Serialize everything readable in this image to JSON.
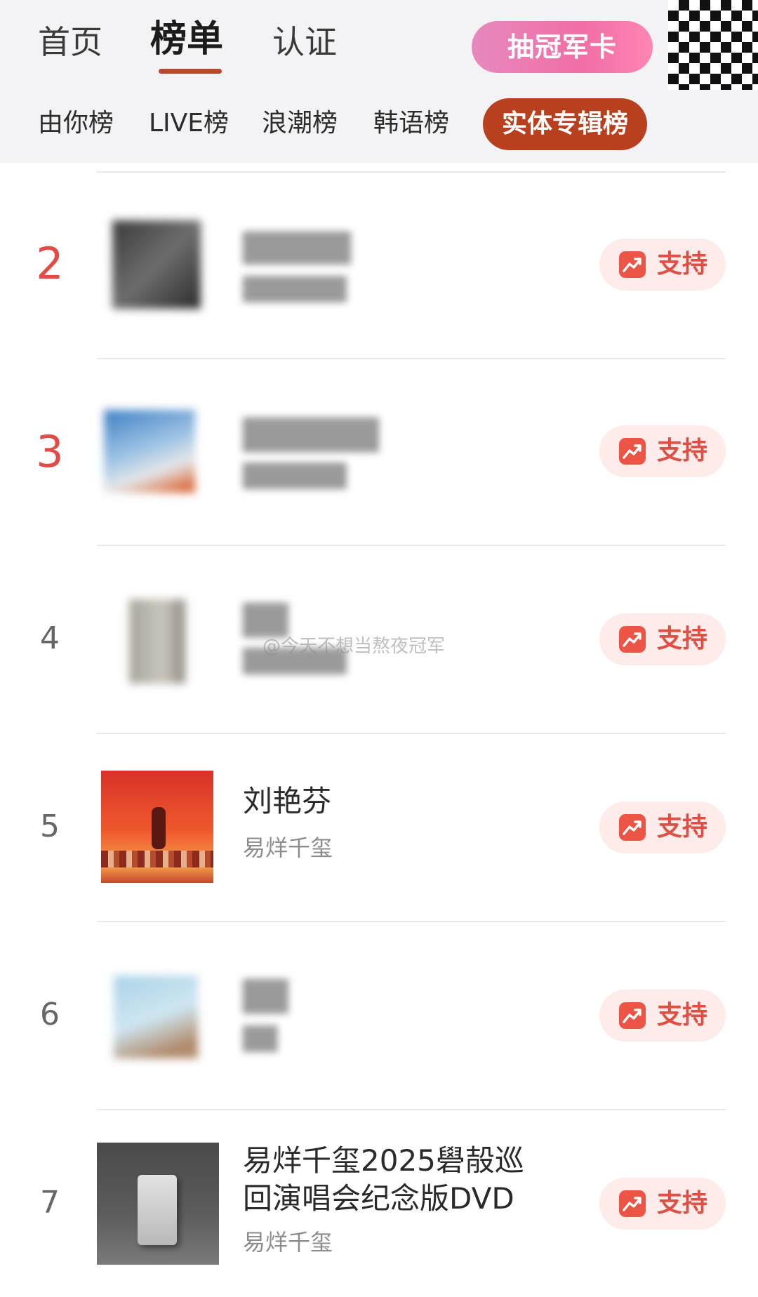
{
  "header": {
    "main_tabs": [
      {
        "label": "首页"
      },
      {
        "label": "榜单"
      },
      {
        "label": "认证"
      }
    ],
    "crown_button": "抽冠军卡",
    "sub_tabs": [
      {
        "label": "由你榜"
      },
      {
        "label": "LIVE榜"
      },
      {
        "label": "浪潮榜"
      },
      {
        "label": "韩语榜"
      },
      {
        "label": "实体专辑榜"
      }
    ]
  },
  "support_label": "支持",
  "watermark": "@今天不想当熬夜冠军",
  "rows": [
    {
      "rank": "2",
      "title": "",
      "artist": ""
    },
    {
      "rank": "3",
      "title": "",
      "artist": ""
    },
    {
      "rank": "4",
      "title": "",
      "artist": ""
    },
    {
      "rank": "5",
      "title": "刘艳芬",
      "artist": "易烊千玺"
    },
    {
      "rank": "6",
      "title": "",
      "artist": ""
    },
    {
      "rank": "7",
      "title_line1": "易烊千玺2025礐㱿巡",
      "title_line2": "回演唱会纪念版DVD",
      "artist": "易烊千玺"
    }
  ],
  "colors": {
    "accent": "#b8401f",
    "rank_top": "#e24c44",
    "support_bg": "#fdecea",
    "support_icon": "#ec5546",
    "crown_pink": "#f06ea5"
  }
}
